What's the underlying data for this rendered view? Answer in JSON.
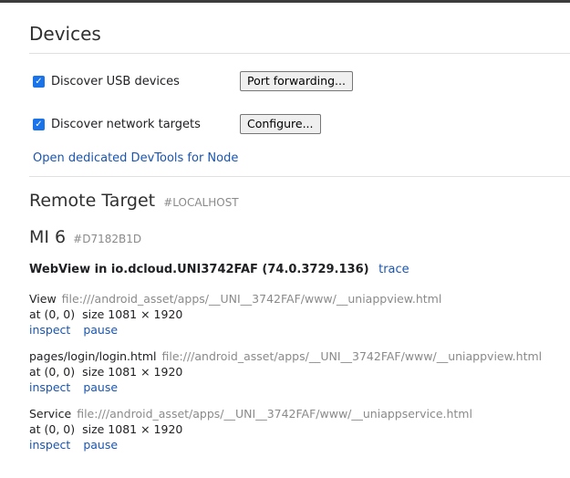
{
  "page": {
    "title": "Devices"
  },
  "settings": {
    "usb_label": "Discover USB devices",
    "usb_checked": true,
    "port_forwarding_button": "Port forwarding...",
    "network_label": "Discover network targets",
    "network_checked": true,
    "configure_button": "Configure...",
    "node_link": "Open dedicated DevTools for Node"
  },
  "remote": {
    "title": "Remote Target",
    "host": "#LOCALHOST",
    "device_name": "MI 6",
    "device_id": "#D7182B1D",
    "browser": "WebView in io.dcloud.UNI3742FAF (74.0.3729.136)",
    "trace_link": "trace",
    "targets": [
      {
        "name": "View",
        "url": "file:///android_asset/apps/__UNI__3742FAF/www/__uniappview.html",
        "position": "at (0, 0)",
        "size": "size 1081 × 1920",
        "inspect": "inspect",
        "pause": "pause"
      },
      {
        "name": "pages/login/login.html",
        "url": "file:///android_asset/apps/__UNI__3742FAF/www/__uniappview.html",
        "position": "at (0, 0)",
        "size": "size 1081 × 1920",
        "inspect": "inspect",
        "pause": "pause"
      },
      {
        "name": "Service",
        "url": "file:///android_asset/apps/__UNI__3742FAF/www/__uniappservice.html",
        "position": "at (0, 0)",
        "size": "size 1081 × 1920",
        "inspect": "inspect",
        "pause": "pause"
      }
    ]
  },
  "colors": {
    "accent": "#1a73e8",
    "link": "#1a55b0",
    "muted": "#8a8a8a"
  }
}
